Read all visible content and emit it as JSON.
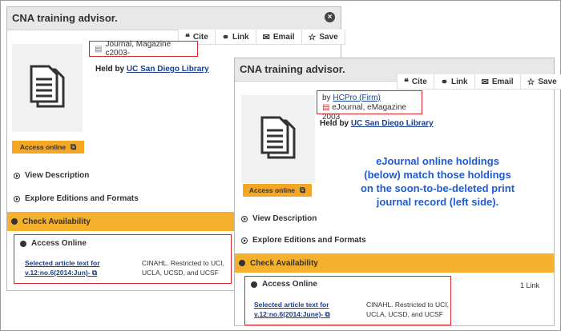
{
  "left": {
    "window_title": "CNA training advisor.",
    "toolbar": {
      "cite": "Cite",
      "link": "Link",
      "email": "Email",
      "save": "Save"
    },
    "format": "Journal, Magazine c2003-",
    "held_prefix": "Held by",
    "held_library": "UC San Diego Library",
    "access_button": "Access online",
    "view_description": "View Description",
    "explore_editions": "Explore Editions and Formats",
    "check_availability": "Check Availability",
    "access_online": "Access Online",
    "article_link_1": "Selected article text for",
    "article_link_2": "v.12:no.6(2014:Jun)-",
    "coverage_1": "CINAHL. Restricted to UCI,",
    "coverage_2": "UCLA, UCSD, and UCSF"
  },
  "right": {
    "window_title": "CNA training advisor.",
    "toolbar": {
      "cite": "Cite",
      "link": "Link",
      "email": "Email",
      "save": "Save"
    },
    "by_prefix": "by",
    "by_link": "HCPro (Firm)",
    "format": "eJournal, eMagazine 2003",
    "held_prefix": "Held by",
    "held_library": "UC San Diego Library",
    "access_button": "Access online",
    "view_description": "View Description",
    "explore_editions": "Explore Editions and Formats",
    "check_availability": "Check Availability",
    "access_online": "Access Online",
    "link_count": "1 Link",
    "article_link_1": "Selected article text for",
    "article_link_2": "v.12:no.6(2014:June)-",
    "coverage_1": "CINAHL. Restricted to UCI,",
    "coverage_2": "UCLA, UCSD, and UCSF"
  },
  "annotation": {
    "line1": "eJournal online holdings",
    "line2": "(below) match those holdings",
    "line3": "on the soon-to-be-deleted print",
    "line4": "journal record (left side)."
  },
  "colors": {
    "accent": "#f5a623",
    "highlight": "#d9262c",
    "note": "#1e5bd6",
    "link": "#1a3e8c"
  }
}
